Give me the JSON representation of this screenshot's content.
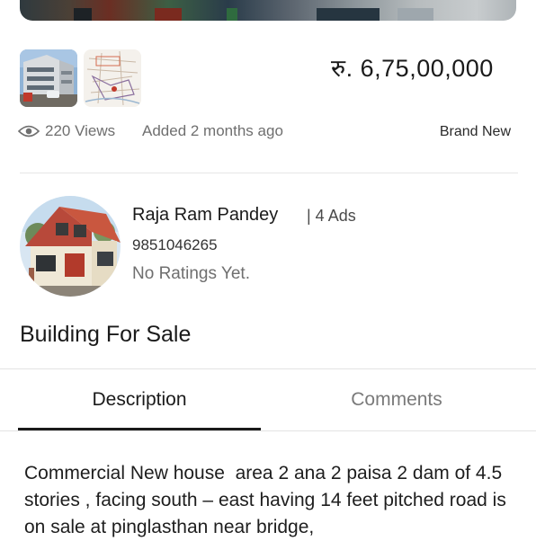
{
  "listing": {
    "price": "रु. 6,75,00,000",
    "views": "220 Views",
    "added": "Added 2 months ago",
    "condition": "Brand New",
    "title": "Building For Sale"
  },
  "seller": {
    "name": "Raja Ram Pandey",
    "ads": "| 4 Ads",
    "phone": "9851046265",
    "ratings": "No Ratings Yet."
  },
  "tabs": {
    "description": "Description",
    "comments": "Comments"
  },
  "description": {
    "text": "Commercial New house  area 2 ana 2 paisa 2 dam of 4.5 stories , facing south – east having 14 feet pitched road is on sale at pinglasthan near bridge,"
  },
  "icons": {
    "views": "eye-icon"
  },
  "colors": {
    "text": "#1e1e1e",
    "muted": "#6f6f6f",
    "divider": "#e6e6e6",
    "active_tab": "#1a1a1a"
  }
}
